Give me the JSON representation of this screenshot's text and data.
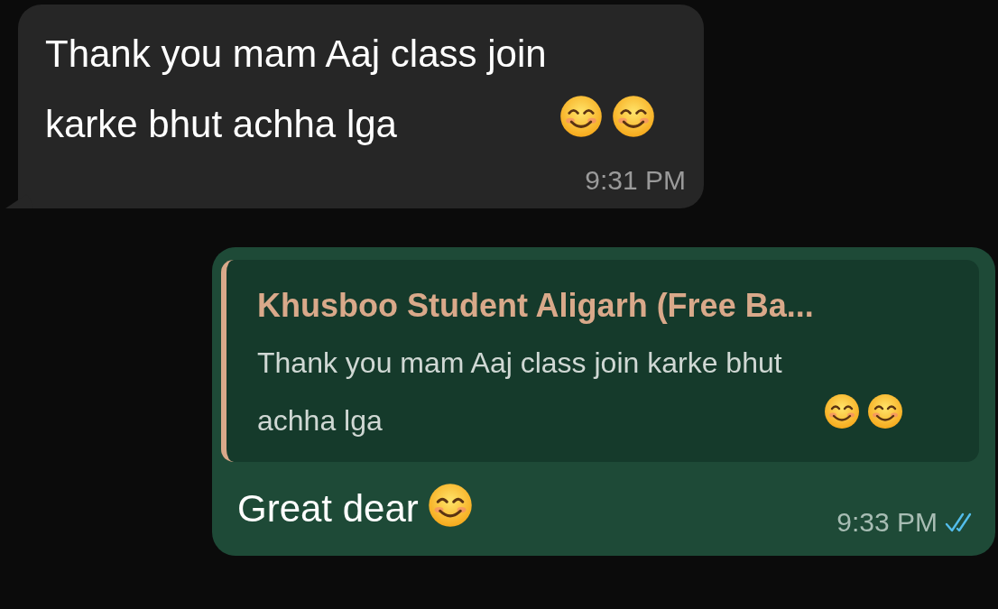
{
  "messages": [
    {
      "kind": "incoming",
      "text": "Thank you mam Aaj class join karke bhut achha lga",
      "emoji": [
        {
          "kind": "smiling-face"
        },
        {
          "kind": "smiling-face"
        }
      ],
      "time": "9:31 PM"
    },
    {
      "kind": "outgoing",
      "quote": {
        "author": "Khusboo Student Aligarh (Free Ba...",
        "text": "Thank you mam Aaj class join karke bhut achha lga",
        "emoji": [
          {
            "kind": "smiling-face"
          },
          {
            "kind": "smiling-face"
          }
        ]
      },
      "text": "Great dear",
      "emoji": [
        {
          "kind": "smiling-face"
        }
      ],
      "time": "9:33 PM",
      "read": true
    }
  ]
}
